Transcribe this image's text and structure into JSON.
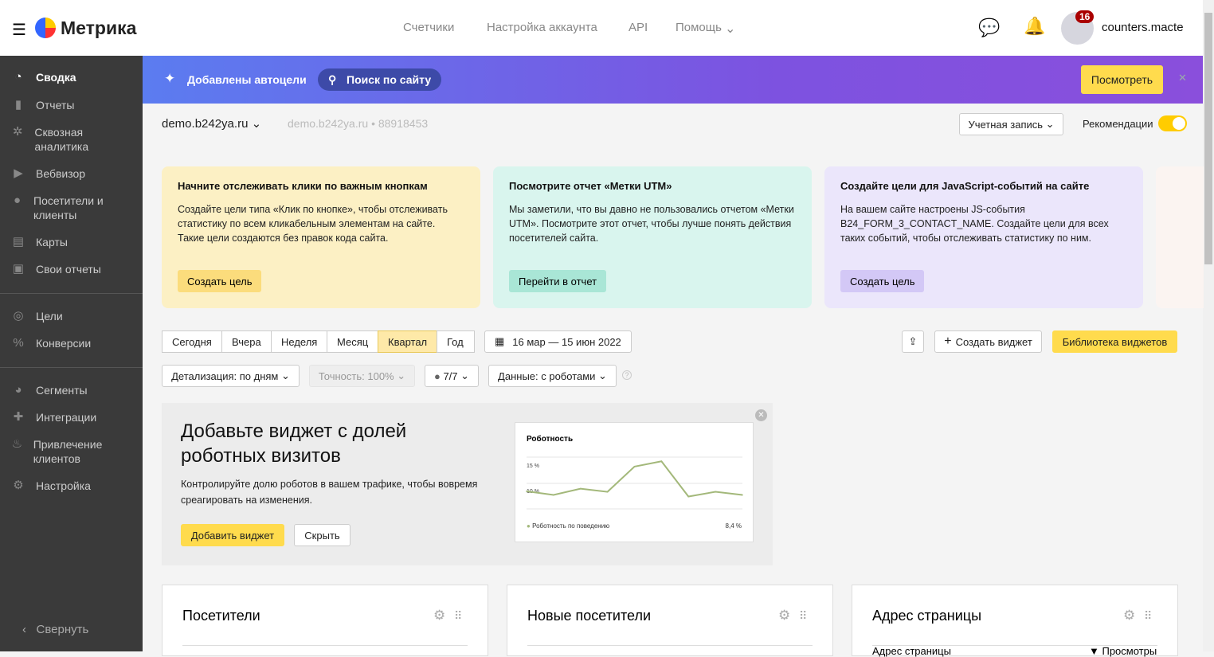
{
  "header": {
    "logo": "Метрика",
    "nav": [
      "Счетчики",
      "Настройка аккаунта",
      "API",
      "Помощь"
    ],
    "notifications": "16",
    "user": "counters.macte"
  },
  "sidebar": {
    "items": [
      {
        "label": "Сводка",
        "icon": "dashboard-icon"
      },
      {
        "label": "Отчеты",
        "icon": "bar-chart-icon"
      },
      {
        "label": "Сквозная аналитика",
        "icon": "gear-cluster-icon"
      },
      {
        "label": "Вебвизор",
        "icon": "play-icon"
      },
      {
        "label": "Посетители и клиенты",
        "icon": "user-icon"
      },
      {
        "label": "Карты",
        "icon": "map-icon"
      },
      {
        "label": "Свои отчеты",
        "icon": "inbox-icon"
      },
      {
        "label": "Цели",
        "icon": "target-icon"
      },
      {
        "label": "Конверсии",
        "icon": "percent-icon"
      },
      {
        "label": "Сегменты",
        "icon": "pie-icon"
      },
      {
        "label": "Интеграции",
        "icon": "puzzle-icon"
      },
      {
        "label": "Привлечение клиентов",
        "icon": "fire-icon"
      },
      {
        "label": "Настройка",
        "icon": "settings-icon"
      }
    ],
    "collapse": "Свернуть"
  },
  "banner": {
    "title": "Добавлены автоцели",
    "search": "Поиск по сайту",
    "view": "Посмотреть"
  },
  "counter": {
    "name": "demo.b242ya.ru",
    "sub": "demo.b242ya.ru • 88918453",
    "account": "Учетная запись",
    "recs": "Рекомендации",
    "recs_on": true
  },
  "cards": [
    {
      "title": "Начните отслеживать клики по важным кнопкам",
      "text": "Создайте цели типа «Клик по кнопке», чтобы отслеживать статистику по всем кликабельным элементам на сайте. Такие цели создаются без правок кода сайта.",
      "button": "Создать цель",
      "bg": "#fcf0c4",
      "btn": "#fbdc7c"
    },
    {
      "title": "Посмотрите отчет «Метки UTM»",
      "text": "Мы заметили, что вы давно не пользовались отчетом «Метки UTM». Посмотрите этот отчет, чтобы лучше понять действия посетителей сайта.",
      "button": "Перейти в отчет",
      "bg": "#d9f5ee",
      "btn": "#a9e6d6"
    },
    {
      "title": "Создайте цели для JavaScript-событий на сайте",
      "text": "На вашем сайте настроены JS-события B24_FORM_3_CONTACT_NAME. Создайте цели для всех таких событий, чтобы отслеживать статистику по ним.",
      "button": "Создать цель",
      "bg": "#ebe6fb",
      "btn": "#d3c8f6"
    }
  ],
  "periods": [
    "Сегодня",
    "Вчера",
    "Неделя",
    "Месяц",
    "Квартал",
    "Год"
  ],
  "active_period": "Квартал",
  "date_range": "16 мар — 15 июн 2022",
  "actions": {
    "create_widget": "Создать виджет",
    "library": "Библиотека виджетов"
  },
  "filters": {
    "detail": "Детализация: по дням",
    "accuracy": "Точность: 100%",
    "segments": "7/7",
    "data": "Данные: с роботами"
  },
  "promo": {
    "title": "Добавьте виджет с долей роботных визитов",
    "text": "Контролируйте долю роботов в вашем трафике, чтобы вовремя среагировать на изменения.",
    "add": "Добавить виджет",
    "hide": "Скрыть"
  },
  "chart_data": {
    "type": "line",
    "title": "Роботность",
    "ytick_labels": [
      "15 %",
      "10 %"
    ],
    "series": [
      {
        "name": "Роботность по поведению",
        "values": [
          8.5,
          7.8,
          9,
          8.4,
          13.2,
          14.2,
          7.5,
          8.4,
          7.8
        ]
      }
    ],
    "total": "8,4 %",
    "ylim": [
      5,
      16
    ],
    "color": "#a3b87a"
  },
  "widgets": [
    "Посетители",
    "Новые посетители",
    "Адрес страницы"
  ],
  "widget3_cols": [
    "Адрес страницы",
    "▼ Просмотры"
  ]
}
